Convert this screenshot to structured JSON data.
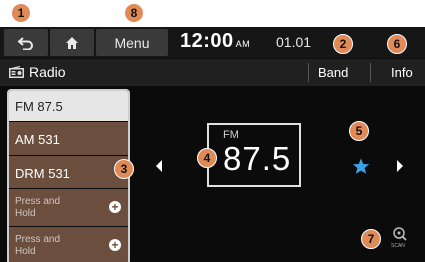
{
  "topbar": {
    "back_icon": "back-arrow-icon",
    "home_icon": "home-icon",
    "menu_label": "Menu",
    "time": "12:00",
    "ampm": "AM",
    "date": "01.01"
  },
  "titlebar": {
    "radio_icon": "radio-icon",
    "title": "Radio",
    "band_label": "Band",
    "info_label": "Info"
  },
  "presets": [
    {
      "label": "FM 87.5",
      "selected": true
    },
    {
      "label": "AM 531",
      "selected": false
    },
    {
      "label": "DRM 531",
      "selected": false
    },
    {
      "label": "Press and Hold",
      "selected": false,
      "add_icon": "plus-icon"
    },
    {
      "label": "Press and Hold",
      "selected": false,
      "add_icon": "plus-icon"
    }
  ],
  "tuner": {
    "band": "FM",
    "frequency": "87.5",
    "favorite_icon": "star-icon",
    "scan_label": "SCAN"
  },
  "callouts": [
    "1",
    "2",
    "3",
    "4",
    "5",
    "6",
    "7",
    "8"
  ],
  "colors": {
    "callout": "#e08a58",
    "preset_bg": "#6b4e3e",
    "star": "#3ba2e6"
  }
}
